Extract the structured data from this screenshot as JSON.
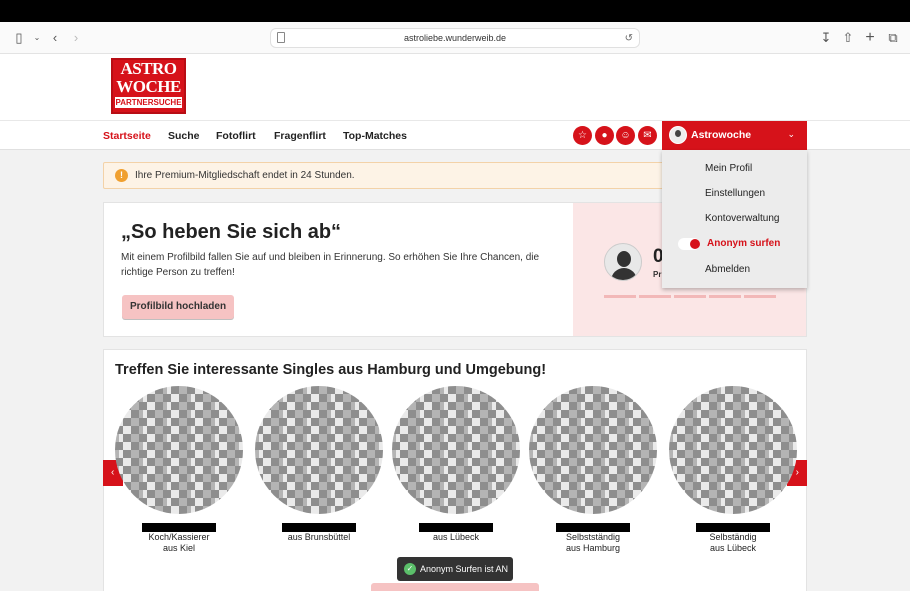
{
  "browser": {
    "url": "astroliebe.wunderweib.de"
  },
  "logo": {
    "line1": "ASTRO",
    "line2": "WOCHE",
    "line3": "PARTNERSUCHE"
  },
  "nav": {
    "items": [
      "Startseite",
      "Suche",
      "Fotoflirt",
      "Fragenflirt",
      "Top-Matches"
    ],
    "account_name": "Astrowoche"
  },
  "account_menu": {
    "items": [
      "Mein Profil",
      "Einstellungen",
      "Kontoverwaltung",
      "Anonym surfen",
      "Abmelden"
    ],
    "anonym_toggle_on": true
  },
  "notice": {
    "text": "Ihre Premium-Mitgliedschaft endet in 24 Stunden."
  },
  "profile_card": {
    "title": "„So heben Sie sich ab“",
    "description": "Mit einem Profilbild fallen Sie auf und bleiben in Erinnerung. So erhöhen Sie Ihre Chancen, die richtige Person zu treffen!",
    "button": "Profilbild hochladen",
    "count": "0",
    "count_label": "Pr"
  },
  "singles": {
    "title": "Treffen Sie interessante Singles aus Hamburg und Umgebung!",
    "people": [
      {
        "line1": "Koch/Kassierer",
        "line2": "aus Kiel"
      },
      {
        "line1": "aus Brunsbüttel",
        "line2": ""
      },
      {
        "line1": "aus Lübeck",
        "line2": ""
      },
      {
        "line1": "Selbstständig",
        "line2": "aus Hamburg"
      },
      {
        "line1": "Selbständig",
        "line2": "aus Lübeck"
      }
    ]
  },
  "toast": {
    "text": "Anonym Surfen ist AN"
  },
  "colors": {
    "brand_red": "#d6121a",
    "notice_bg": "#fdf3e6",
    "toast_bg": "#333333"
  }
}
